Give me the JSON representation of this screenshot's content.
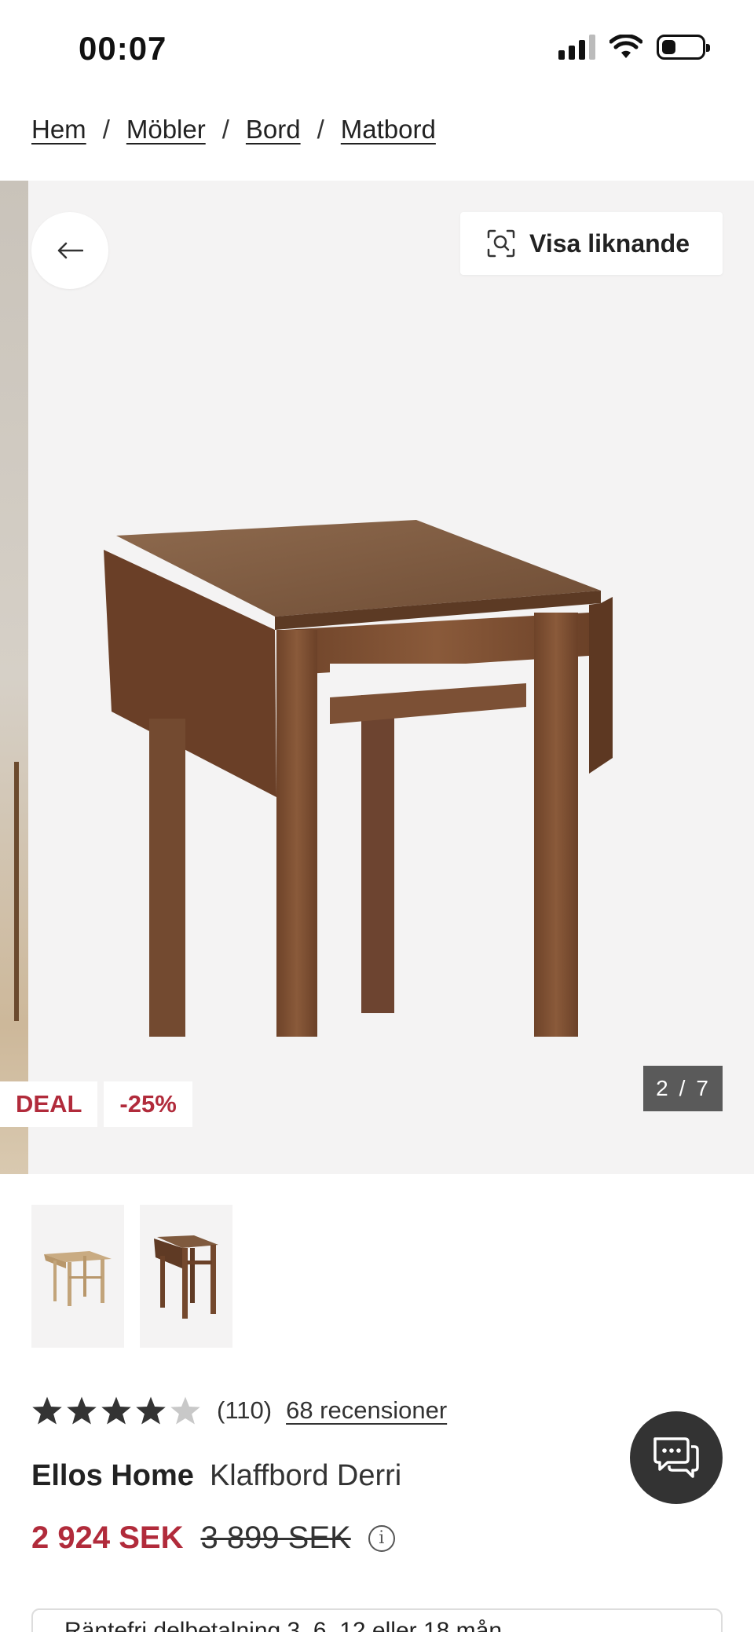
{
  "status_bar": {
    "time": "00:07",
    "battery_level": 0.35
  },
  "breadcrumb": {
    "items": [
      "Hem",
      "Möbler",
      "Bord",
      "Matbord"
    ],
    "separator": "/"
  },
  "gallery": {
    "back_icon": "arrow-left-icon",
    "similar_button": {
      "icon": "visual-search-icon",
      "label": "Visa liknande"
    },
    "badges": {
      "deal": "DEAL",
      "discount": "-25%"
    },
    "counter": {
      "current": "2",
      "separator": "/",
      "total": "7"
    }
  },
  "thumbnails": [
    {
      "name": "light-wood-table-thumb"
    },
    {
      "name": "dark-wood-table-thumb"
    }
  ],
  "product": {
    "rating": 4,
    "rating_max": 5,
    "rating_count": "(110)",
    "reviews_link": "68 recensioner",
    "brand": "Ellos Home",
    "name": "Klaffbord Derri",
    "price_current": "2 924 SEK",
    "price_old": "3 899 SEK",
    "installment_text": "Räntefri delbetalning 3, 6, 12 eller 18 mån"
  },
  "chat": {
    "icon": "chat-bubbles-icon"
  },
  "colors": {
    "sale_red": "#b12b3b",
    "dark": "#333333",
    "gallery_bg": "#f4f3f3"
  }
}
